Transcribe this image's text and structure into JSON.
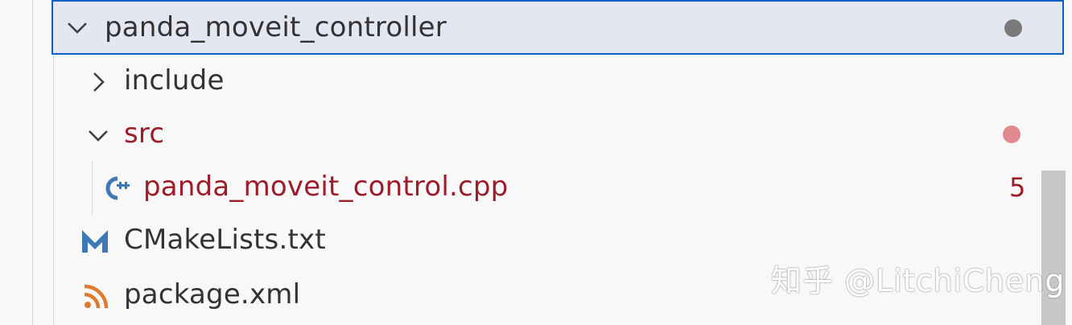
{
  "explorer": {
    "items": [
      {
        "label": "panda_moveit_controller",
        "kind": "folder",
        "expanded": true,
        "status": "dot-gray"
      },
      {
        "label": "include",
        "kind": "folder",
        "expanded": false
      },
      {
        "label": "src",
        "kind": "folder",
        "expanded": true,
        "status": "dot-red"
      },
      {
        "label": "panda_moveit_control.cpp",
        "kind": "file",
        "icon": "cpp-file-icon",
        "problems": "5"
      },
      {
        "label": "CMakeLists.txt",
        "kind": "file",
        "icon": "cmake-file-icon"
      },
      {
        "label": "package.xml",
        "kind": "file",
        "icon": "rss-xml-file-icon"
      }
    ]
  },
  "watermark": "知乎 @LitchiCheng",
  "colors": {
    "selection_border": "#0a5fc7",
    "selection_bg": "#e4e6f1",
    "modified_text": "#9c1c2a",
    "status_gray": "#7a7a7a",
    "status_red": "#e0898f",
    "cpp_icon": "#3f78b6",
    "cmake_icon": "#3f78b6",
    "xml_icon": "#e07a2e"
  }
}
